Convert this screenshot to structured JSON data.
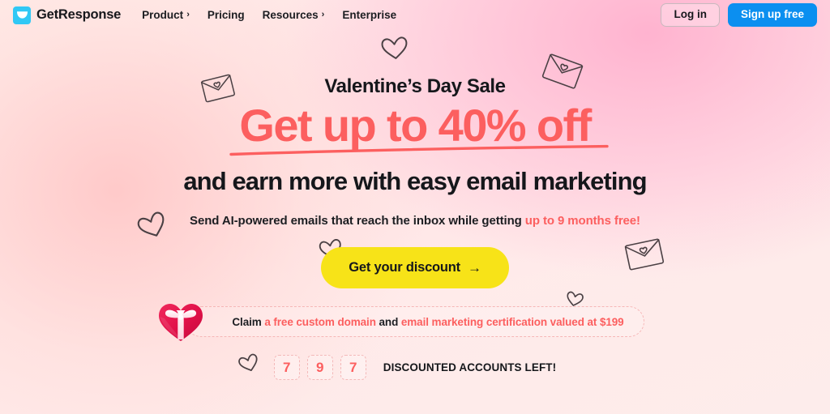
{
  "header": {
    "brand": {
      "name": "GetResponse",
      "icon": "envelope-logo-icon",
      "color": "#30c8f5"
    },
    "nav": [
      {
        "label": "Product",
        "has_caret": true
      },
      {
        "label": "Pricing",
        "has_caret": false
      },
      {
        "label": "Resources",
        "has_caret": true
      },
      {
        "label": "Enterprise",
        "has_caret": false
      }
    ],
    "caret_glyph": "›",
    "login_label": "Log in",
    "signup_label": "Sign up free",
    "signup_color": "#0b8ff0"
  },
  "hero": {
    "eyebrow": "Valentine’s Day Sale",
    "headline": "Get up to 40% off",
    "headline_color": "#fc5f5f",
    "subhead": "and earn more with easy email marketing",
    "lede_prefix": "Send AI-powered emails that reach the inbox while getting ",
    "lede_highlight": "up to 9 months free!",
    "cta_label": "Get your discount",
    "cta_arrow": "→",
    "cta_color": "#f7e318"
  },
  "claim": {
    "icon": "heart-gift-icon",
    "prefix": "Claim ",
    "offer_one": "a free custom domain",
    "joiner": " and ",
    "offer_two": "email marketing certification valued at $199",
    "highlight_color": "#fc5f5f"
  },
  "counter": {
    "digits": [
      "7",
      "9",
      "7"
    ],
    "label": "DISCOUNTED ACCOUNTS LEFT!",
    "digit_color": "#fc5f5f"
  },
  "doodles": [
    {
      "name": "doodle-envelope-heart-left",
      "type": "envelope"
    },
    {
      "name": "doodle-heart-top-center",
      "type": "heart"
    },
    {
      "name": "doodle-envelope-heart-top-right",
      "type": "envelope"
    },
    {
      "name": "doodle-heart-left-mid",
      "type": "heart"
    },
    {
      "name": "doodle-heart-center-small",
      "type": "heart"
    },
    {
      "name": "doodle-envelope-heart-right",
      "type": "envelope"
    },
    {
      "name": "doodle-heart-right-small",
      "type": "heart"
    },
    {
      "name": "doodle-heart-bottom-left",
      "type": "heart"
    }
  ]
}
